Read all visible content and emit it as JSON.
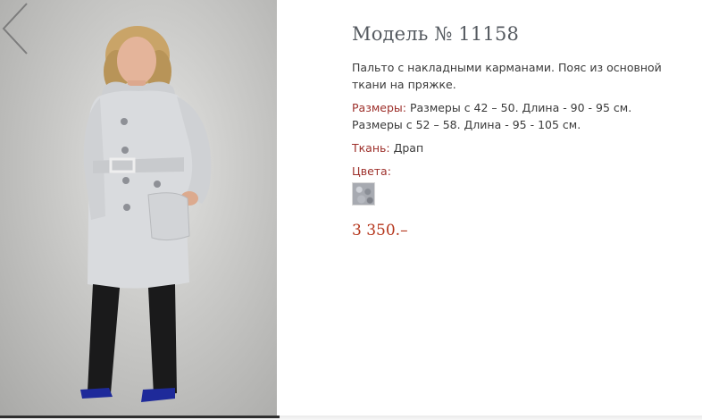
{
  "product": {
    "title": "Модель № 11158",
    "description": "Пальто с накладными карманами. Пояс из основной ткани на пряжке.",
    "sizes_label": "Размеры:",
    "sizes_value": "Размеры с 42 – 50. Длина - 90 - 95 см. Размеры с 52 – 58. Длина - 95 - 105 см.",
    "fabric_label": "Ткань:",
    "fabric_value": "Драп",
    "colors_label": "Цвета:",
    "price": "3 350.–"
  },
  "gallery": {
    "prev_icon": "chevron-left-icon",
    "swatch_icon": "fabric-swatch-grey"
  },
  "colors": {
    "accent": "#9d2f2a",
    "price": "#b5361c",
    "title": "#555a60"
  }
}
